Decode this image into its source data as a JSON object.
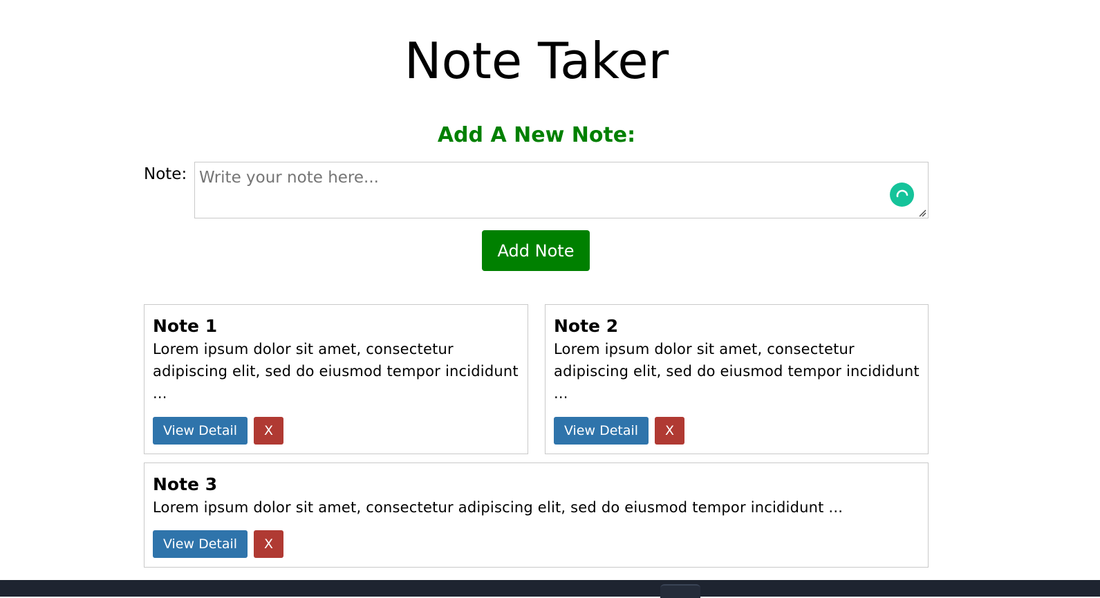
{
  "app": {
    "title": "Note Taker"
  },
  "form": {
    "heading": "Add A New Note:",
    "note_label": "Note:",
    "note_placeholder": "Write your note here...",
    "note_value": "",
    "add_button_label": "Add Note"
  },
  "notes": [
    {
      "title": "Note 1",
      "text": "Lorem ipsum dolor sit amet, consectetur adipiscing elit, sed do eiusmod tempor incididunt ...",
      "view_label": "View Detail",
      "delete_label": "X"
    },
    {
      "title": "Note 2",
      "text": "Lorem ipsum dolor sit amet, consectetur adipiscing elit, sed do eiusmod tempor incididunt ...",
      "view_label": "View Detail",
      "delete_label": "X"
    },
    {
      "title": "Note 3",
      "text": "Lorem ipsum dolor sit amet, consectetur adipiscing elit, sed do eiusmod tempor incididunt ...",
      "view_label": "View Detail",
      "delete_label": "X"
    }
  ],
  "icons": {
    "assistant": "grammar-assistant-icon",
    "resize": "resize-handle-icon"
  },
  "colors": {
    "heading": "#008000",
    "add_button": "#008000",
    "view_button": "#2f74ab",
    "delete_button": "#b03a33",
    "assistant": "#15c39a"
  }
}
